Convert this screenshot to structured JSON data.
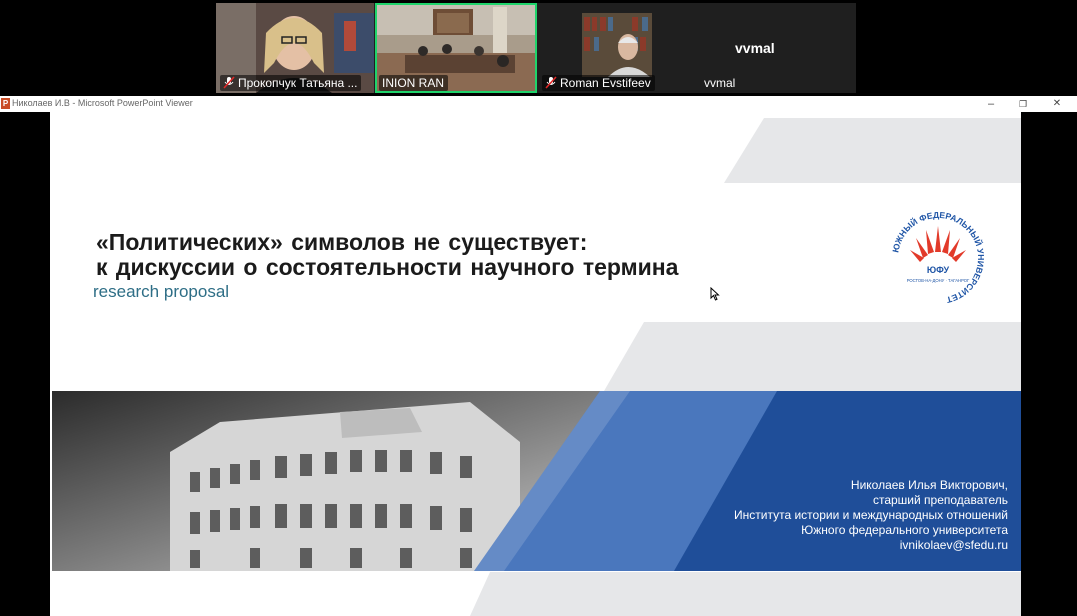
{
  "participants": [
    {
      "name": "Прокопчук Татьяна ...",
      "muted": true
    },
    {
      "name": "INION RAN",
      "muted": false,
      "active_speaker": true
    },
    {
      "name": "Roman Evstifeev",
      "muted": true
    },
    {
      "name": "vvmal",
      "display": "vvmal",
      "muted": false
    }
  ],
  "window": {
    "icon_label": "P",
    "title": "Николаев И.В - Microsoft PowerPoint Viewer",
    "minimize": "–",
    "restore": "❐",
    "close": "✕"
  },
  "slide": {
    "title_line1": "«Политических» символов не существует:",
    "title_line2": "к дискуссии о состоятельности научного термина",
    "subtitle": "research proposal",
    "logo": {
      "ring_text": "ЮЖНЫЙ ФЕДЕРАЛЬНЫЙ УНИВЕРСИТЕТ",
      "center_text": "ЮФУ",
      "bottom_text": "РОСТОВ-НА-ДОНУ · ТАГАНРОГ"
    },
    "author": {
      "name": "Николаев Илья Викторович,",
      "position": "старший преподаватель",
      "institute": "Института истории и международных отношений",
      "university": "Южного федерального университета",
      "email": "ivnikolaev@sfedu.ru"
    }
  },
  "colors": {
    "accent_dark_blue": "#1f4e99",
    "accent_mid_blue": "#4a77bd",
    "light_gray": "#e6e7e9",
    "subtitle_teal": "#2e6e86",
    "active_speaker_border": "#1fd46b",
    "mute_red": "#e02828"
  }
}
